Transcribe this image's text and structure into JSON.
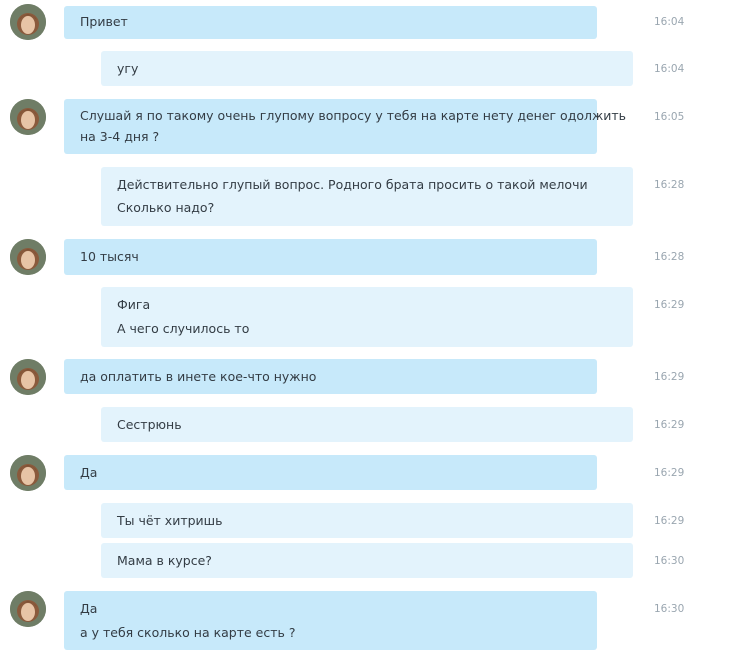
{
  "messages": [
    {
      "side": "in",
      "lines": [
        "Привет"
      ],
      "time": "16:04"
    },
    {
      "side": "out",
      "lines": [
        "угу"
      ],
      "time": "16:04"
    },
    {
      "side": "in",
      "lines": [
        "Слушай я по такому очень глупому вопросу у тебя на карте нету денег одолжить",
        "на 3-4 дня ?"
      ],
      "time": "16:05"
    },
    {
      "side": "out",
      "lines": [
        "Действительно глупый вопрос.  Родного брата просить о такой мелочи",
        "Сколько надо?"
      ],
      "time": "16:28"
    },
    {
      "side": "in",
      "lines": [
        "10 тысяч"
      ],
      "time": "16:28"
    },
    {
      "side": "out",
      "lines": [
        "Фига",
        "А чего случилось то"
      ],
      "time": "16:29"
    },
    {
      "side": "in",
      "lines": [
        "да оплатить в инете кое-что нужно"
      ],
      "time": "16:29"
    },
    {
      "side": "out",
      "lines": [
        "Сестрюнь"
      ],
      "time": "16:29"
    },
    {
      "side": "in",
      "lines": [
        "Да"
      ],
      "time": "16:29"
    },
    {
      "side": "out",
      "lines": [
        "Ты чёт хитришь"
      ],
      "time": "16:29"
    },
    {
      "side": "out",
      "lines": [
        "Мама в курсе?"
      ],
      "time": "16:30"
    },
    {
      "side": "in",
      "lines": [
        "Да",
        "а у тебя сколько на карте есть ?"
      ],
      "time": "16:30"
    }
  ],
  "colors": {
    "incoming_bubble": "#c7e9fa",
    "outgoing_bubble": "#e3f3fc",
    "timestamp": "#9aa6b0",
    "text": "#333c44"
  },
  "icons": {
    "avatar": "avatar-icon"
  }
}
